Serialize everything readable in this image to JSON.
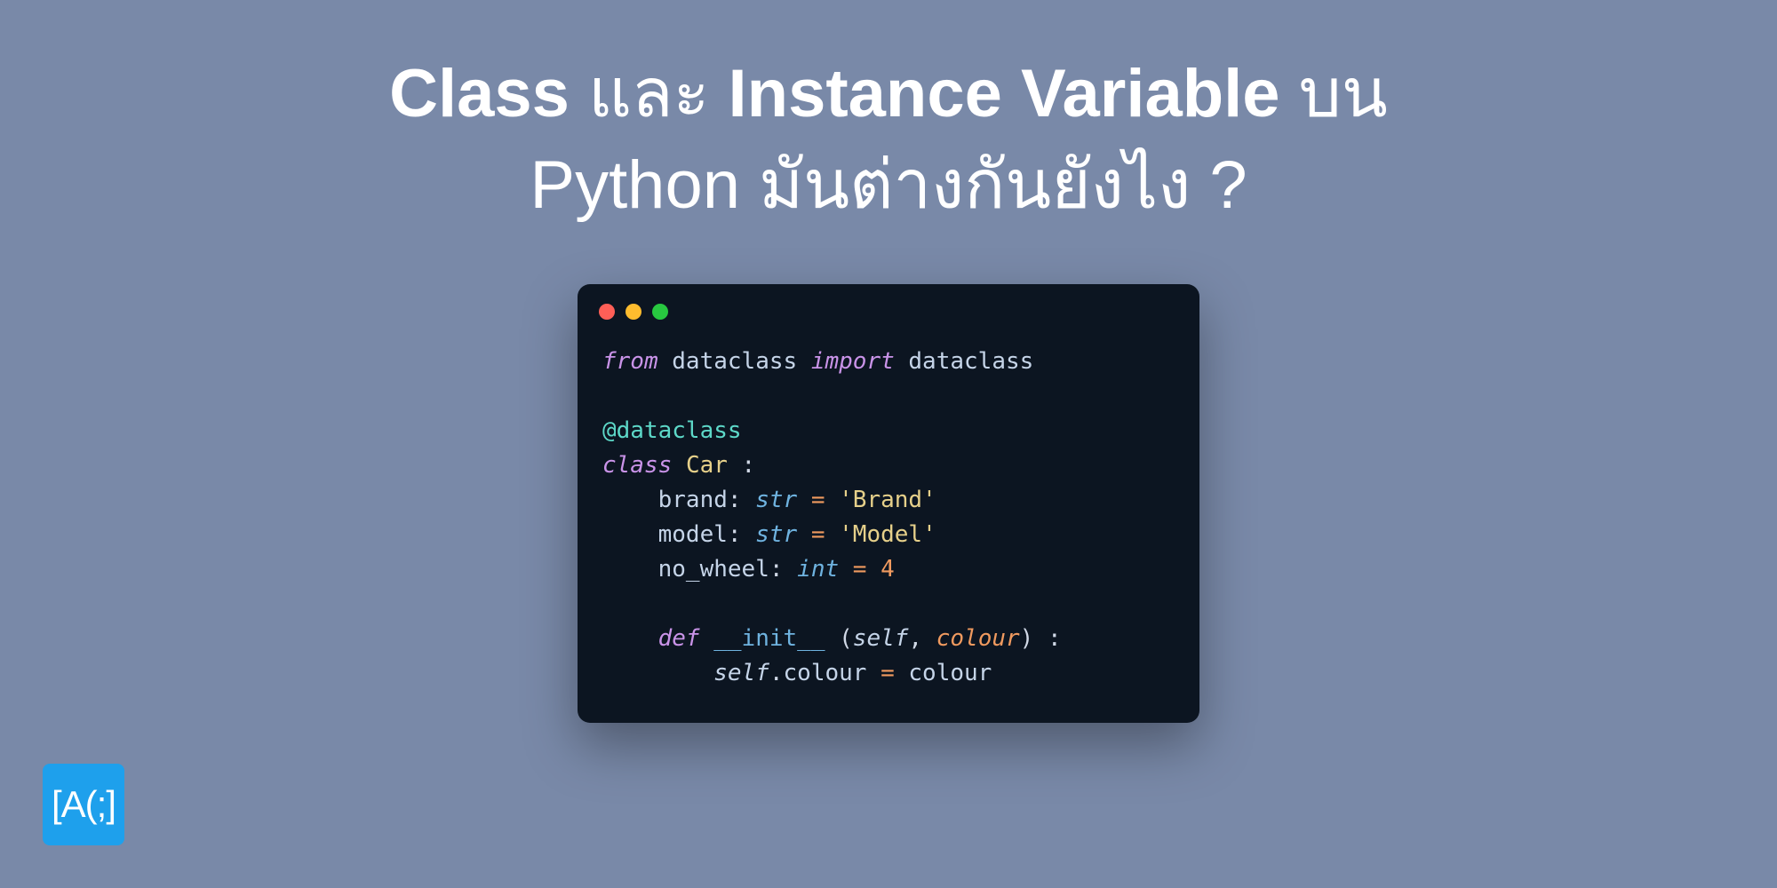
{
  "heading": {
    "part1_bold": "Class",
    "part2": " และ ",
    "part3_bold": "Instance Variable",
    "part4": " บน",
    "line2": "Python มันต่างกันยังไง ?"
  },
  "code": {
    "l1": {
      "from": "from",
      "mod1": "dataclass",
      "import": "import",
      "mod2": "dataclass"
    },
    "l2": "",
    "l3": {
      "decorator": "@dataclass"
    },
    "l4": {
      "kw": "class",
      "name": "Car",
      "colon": " :"
    },
    "l5": {
      "attr": "brand",
      "colon1": ":",
      "type": "str",
      "eq": "=",
      "val": "'Brand'"
    },
    "l6": {
      "attr": "model",
      "colon1": ":",
      "type": "str",
      "eq": "=",
      "val": "'Model'"
    },
    "l7": {
      "attr": "no_wheel",
      "colon1": ":",
      "type": "int",
      "eq": "=",
      "val": "4"
    },
    "l8": "",
    "l9": {
      "def": "def",
      "fn": "__init__",
      "open": " (",
      "self": "self",
      "comma": ", ",
      "p1": "colour",
      "close": ") :"
    },
    "l10": {
      "self": "self",
      "dot": ".",
      "attr": "colour",
      "eq": " = ",
      "val": "colour"
    }
  },
  "logo": "[A(;]"
}
